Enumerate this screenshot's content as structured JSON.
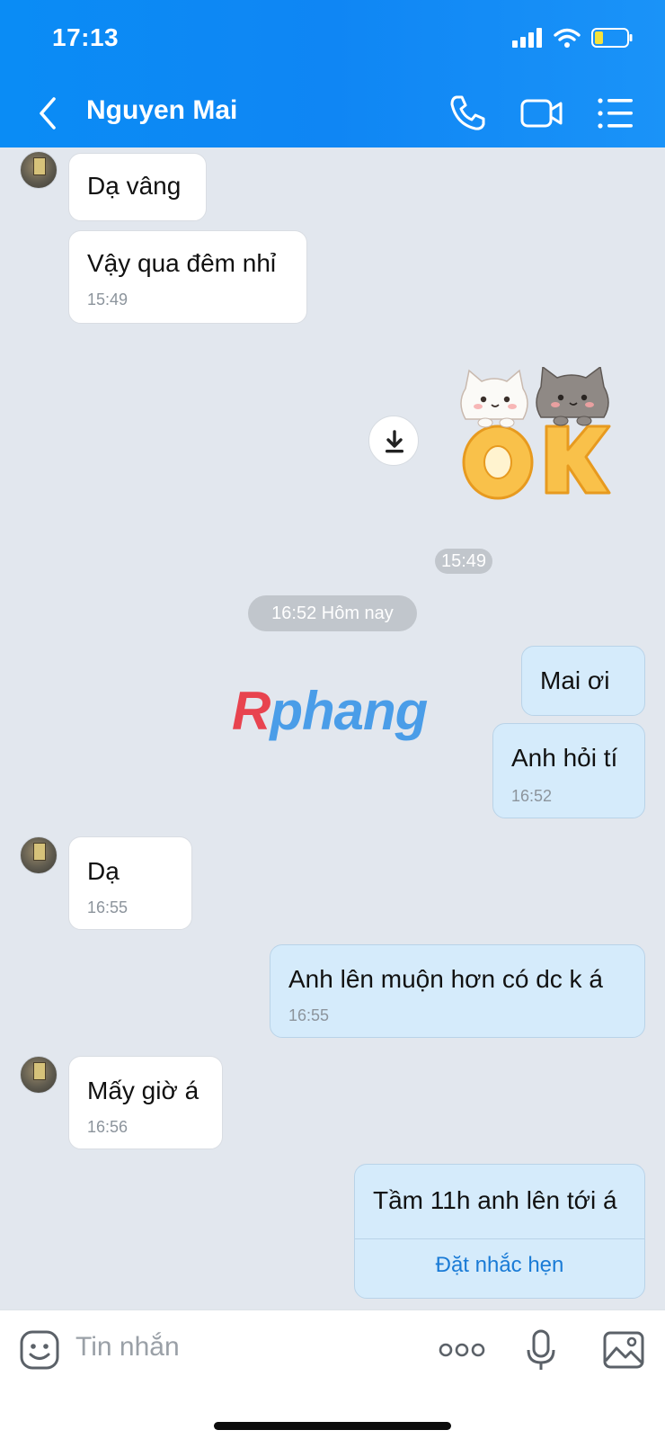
{
  "status_bar": {
    "time": "17:13"
  },
  "header": {
    "contact_name": "Nguyen Mai",
    "icons": [
      "back-arrow-icon",
      "phone-icon",
      "video-call-icon",
      "menu-list-icon"
    ]
  },
  "messages": {
    "m1": {
      "text": "Dạ vâng"
    },
    "m2": {
      "text": "Vậy qua đêm nhỉ",
      "time": "15:49"
    },
    "sticker": {
      "time": "15:49",
      "label": "OK"
    },
    "date_divider": "16:52 Hôm nay",
    "m3": {
      "text": "Mai ơi"
    },
    "m4": {
      "text": "Anh hỏi tí",
      "time": "16:52"
    },
    "m5": {
      "text": "Dạ",
      "time": "16:55"
    },
    "m6": {
      "text": "Anh lên muộn hơn có dc k á",
      "time": "16:55"
    },
    "m7": {
      "text": "Mấy giờ á",
      "time": "16:56"
    },
    "m8": {
      "text": "Tầm 11h anh lên tới á",
      "action": "Đặt nhắc hẹn"
    }
  },
  "watermark": {
    "part1": "R",
    "part2": "phang"
  },
  "input": {
    "placeholder": "Tin nhắn"
  },
  "colors": {
    "header": "#0f86f4",
    "outgoing_bubble": "#d5ebfb",
    "incoming_bubble": "#ffffff",
    "background": "#e2e7ee",
    "link": "#1a7bd6"
  }
}
